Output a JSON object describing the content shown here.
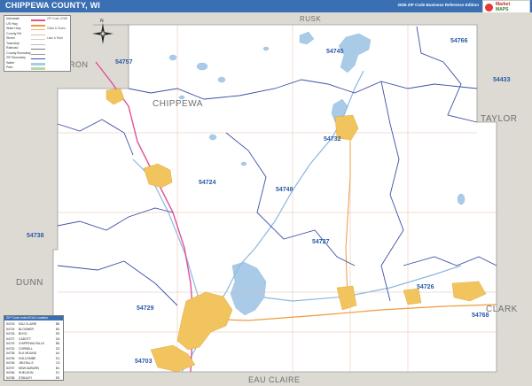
{
  "header": {
    "title": "CHIPPEWA COUNTY, WI",
    "subtitle": "2026 ZIP Code Business Reference Edition"
  },
  "logo": {
    "line1": "Market",
    "line2": "MAPS"
  },
  "colors": {
    "header_bg": "#3a6fb3",
    "outside_land": "#dcdad2",
    "county_bg": "#ffffff",
    "water": "#a9cbe8",
    "zip_boundary": "#3d4fa6",
    "urban": "#f2c45e",
    "highway": "#e0509a",
    "zip_label": "#2a5aa8"
  },
  "legend": {
    "rows": [
      {
        "label": "Interstate",
        "note": "ZIP Code 12345"
      },
      {
        "label": "US Hwy",
        "note": ""
      },
      {
        "label": "State Hwy",
        "note": "Cities & Towns"
      },
      {
        "label": "County Rd",
        "note": ""
      },
      {
        "label": "Street",
        "note": "Lake & River"
      },
      {
        "label": "Township",
        "note": ""
      },
      {
        "label": "Railroad",
        "note": ""
      },
      {
        "label": "County Boundary",
        "note": ""
      },
      {
        "label": "ZIP Boundary",
        "note": ""
      },
      {
        "label": "Water",
        "note": ""
      },
      {
        "label": "Park",
        "note": ""
      }
    ]
  },
  "compass": {
    "label": "N"
  },
  "county_labels": {
    "rusk": "RUSK",
    "barron": "BARRON",
    "chippewa": "CHIPPEWA",
    "taylor": "TAYLOR",
    "dunn": "DUNN",
    "clark": "CLARK",
    "eau_claire": "EAU CLAIRE"
  },
  "zip_labels": {
    "z54745": "54745",
    "z54766": "54766",
    "z54757": "54757",
    "z54433": "54433",
    "z54732": "54732",
    "z54724": "54724",
    "z54748": "54748",
    "z54738": "54738",
    "z54727": "54727",
    "z54726": "54726",
    "z54729": "54729",
    "z54768": "54768",
    "z54703": "54703"
  },
  "zip_table": {
    "header": "ZIP Code Index/Grid Location",
    "rows": [
      {
        "zip": "54703",
        "city": "EAU CLAIRE",
        "grid": "B6"
      },
      {
        "zip": "54724",
        "city": "BLOOMER",
        "grid": "B3"
      },
      {
        "zip": "54726",
        "city": "BOYD",
        "grid": "E5"
      },
      {
        "zip": "54727",
        "city": "CADOTT",
        "grid": "D4"
      },
      {
        "zip": "54729",
        "city": "CHIPPEWA FALLS",
        "grid": "B5"
      },
      {
        "zip": "54732",
        "city": "CORNELL",
        "grid": "D2"
      },
      {
        "zip": "54738",
        "city": "ELK MOUND",
        "grid": "A4"
      },
      {
        "zip": "54745",
        "city": "HOLCOMBE",
        "grid": "D1"
      },
      {
        "zip": "54748",
        "city": "JIM FALLS",
        "grid": "C3"
      },
      {
        "zip": "54757",
        "city": "NEW AUBURN",
        "grid": "B1"
      },
      {
        "zip": "54766",
        "city": "SHELDON",
        "grid": "E1"
      },
      {
        "zip": "54768",
        "city": "STANLEY",
        "grid": "E5"
      }
    ]
  }
}
